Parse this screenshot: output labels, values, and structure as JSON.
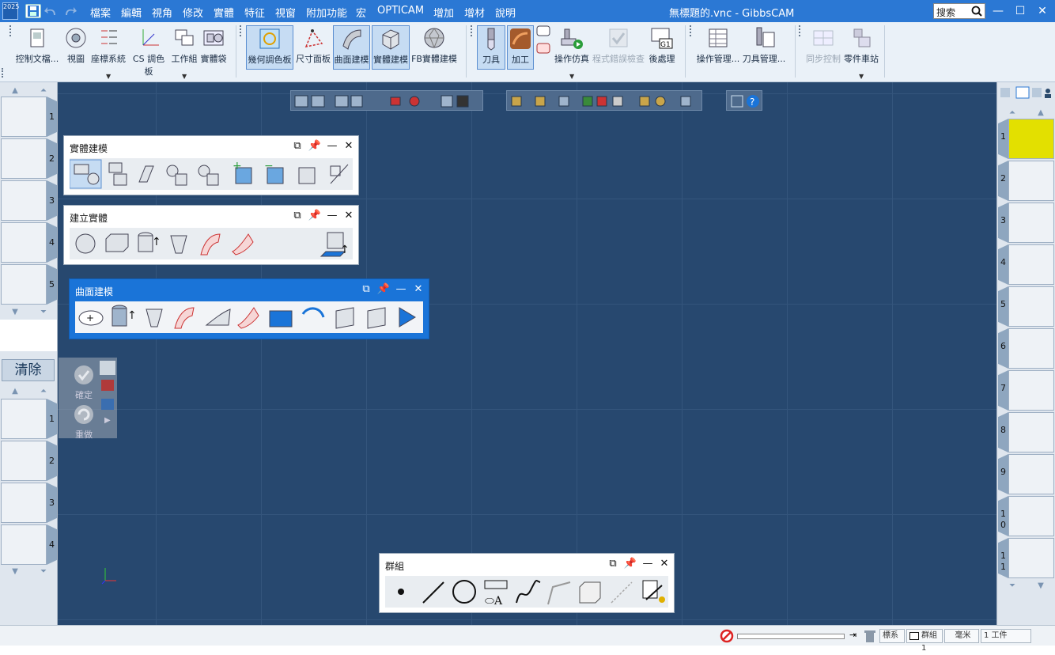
{
  "app": {
    "title": "無標題的.vnc - GibbsCAM",
    "logo_text": "2025"
  },
  "menu": [
    "檔案",
    "編輯",
    "視角",
    "修改",
    "實體",
    "特征",
    "視窗",
    "附加功能",
    "宏",
    "OPTICAM",
    "增加",
    "增材",
    "說明"
  ],
  "search": {
    "placeholder": "搜索"
  },
  "ribbon": {
    "buttons": [
      {
        "label": "控制文檔..."
      },
      {
        "label": "視圖"
      },
      {
        "label": "座標系統"
      },
      {
        "label": "CS 調色板"
      },
      {
        "label": "工作組"
      },
      {
        "label": "實體袋"
      },
      {
        "label": "幾何調色板"
      },
      {
        "label": "尺寸面板"
      },
      {
        "label": "曲面建模"
      },
      {
        "label": "實體建模"
      },
      {
        "label": "FB實體建模"
      },
      {
        "label": "刀具"
      },
      {
        "label": "加工"
      },
      {
        "label": "操作仿真"
      },
      {
        "label": "程式錯誤檢查"
      },
      {
        "label": "後處理"
      },
      {
        "label": "操作管理..."
      },
      {
        "label": "刀具管理..."
      },
      {
        "label": "同步控制"
      },
      {
        "label": "零件車站"
      }
    ]
  },
  "left_panel": {
    "top_tabs": [
      "1",
      "2",
      "3",
      "4",
      "5"
    ],
    "clear_label": "清除",
    "bottom_tabs": [
      "1",
      "2",
      "3",
      "4"
    ],
    "ops": {
      "ok": "確定",
      "redo": "重做"
    }
  },
  "right_panel": {
    "tabs": [
      "1",
      "2",
      "3",
      "4",
      "5",
      "6",
      "7",
      "8",
      "9",
      "10",
      "11"
    ],
    "selected_tab": "1",
    "selected_color": "#e3e000"
  },
  "windows": {
    "solid_modeling": {
      "title": "實體建模"
    },
    "create_solid": {
      "title": "建立實體"
    },
    "surface_modeling": {
      "title": "曲面建模"
    },
    "group": {
      "title": "群組"
    }
  },
  "statusbar": {
    "coord": "標系統",
    "group": "群組1",
    "unit": "毫米",
    "workpiece": "1 工件"
  },
  "colors": {
    "accent": "#2b78d4",
    "canvas": "#27486f"
  }
}
